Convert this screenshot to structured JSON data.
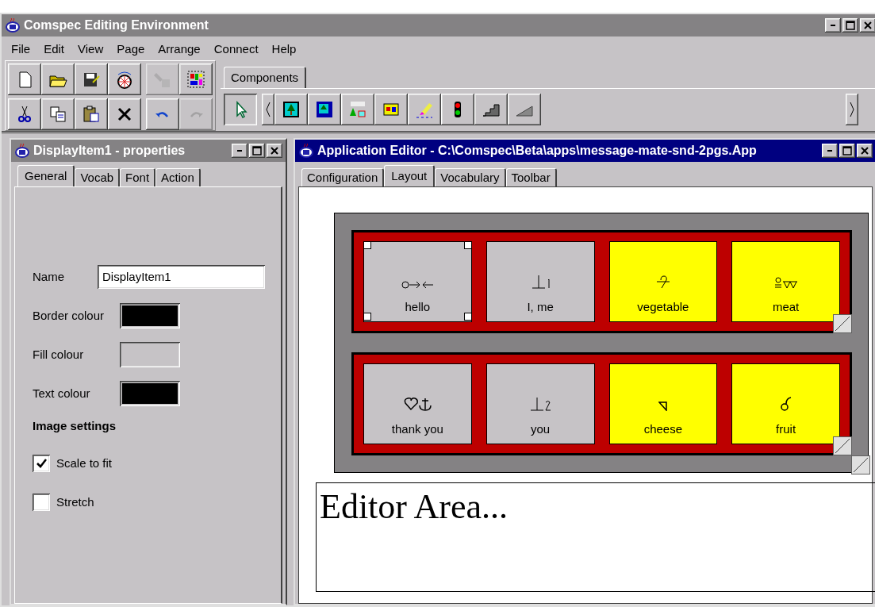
{
  "app_window": {
    "title": "Comspec Editing Environment",
    "active": false
  },
  "menu": [
    "File",
    "Edit",
    "View",
    "Page",
    "Arrange",
    "Connect",
    "Help"
  ],
  "toolbar": [
    [
      {
        "disabled": false
      },
      {
        "disabled": false
      },
      {
        "disabled": false
      },
      {
        "disabled": false
      },
      {
        "disabled": true
      },
      {
        "disabled": false
      }
    ],
    [
      {
        "disabled": false
      },
      {
        "disabled": false
      },
      {
        "disabled": false
      },
      {
        "disabled": false
      },
      {
        "disabled": false
      },
      {
        "disabled": true
      }
    ]
  ],
  "palette_tabs": [
    {
      "label": "Components",
      "selected": true
    }
  ],
  "palette": [
    {
      "selected": true
    },
    {
      "selected": false
    },
    {
      "selected": false
    },
    {
      "selected": false
    },
    {
      "selected": false
    },
    {
      "selected": false
    },
    {
      "selected": false
    },
    {
      "selected": false
    },
    {
      "selected": false
    }
  ],
  "properties": {
    "title": "DisplayItem1 - properties",
    "active": false,
    "tabs": [
      {
        "label": "General",
        "selected": true
      },
      {
        "label": "Vocab",
        "selected": false
      },
      {
        "label": "Font",
        "selected": false
      },
      {
        "label": "Action",
        "selected": false
      }
    ],
    "name_label": "Name",
    "name_value": "DisplayItem1",
    "colours": [
      {
        "label": "Border colour",
        "color": "#000000"
      },
      {
        "label": "Fill colour",
        "color": "#c6c3c6"
      },
      {
        "label": "Text colour",
        "color": "#000000"
      }
    ],
    "image_heading": "Image settings",
    "options": [
      {
        "label": "Scale to fit",
        "checked": true
      },
      {
        "label": "Stretch",
        "checked": false
      }
    ]
  },
  "editor": {
    "title": "Application Editor - C:\\Comspec\\Beta\\apps\\message-mate-snd-2pgs.App",
    "active": true,
    "tabs": [
      {
        "label": "Configuration",
        "selected": false
      },
      {
        "label": "Layout",
        "selected": true
      },
      {
        "label": "Vocabulary",
        "selected": false
      },
      {
        "label": "Toolbar",
        "selected": false
      }
    ],
    "rows": [
      {
        "cells": [
          {
            "label": "hello",
            "color": "#c6c3c6",
            "selected": true
          },
          {
            "label": "I, me",
            "color": "#c6c3c6",
            "selected": false
          },
          {
            "label": "vegetable",
            "color": "#ffff00",
            "selected": false
          },
          {
            "label": "meat",
            "color": "#ffff00",
            "selected": false
          }
        ]
      },
      {
        "cells": [
          {
            "label": "thank you",
            "color": "#c6c3c6",
            "selected": false
          },
          {
            "label": "you",
            "color": "#c6c3c6",
            "selected": false
          },
          {
            "label": "cheese",
            "color": "#ffff00",
            "selected": false
          },
          {
            "label": "fruit",
            "color": "#ffff00",
            "selected": false
          }
        ]
      }
    ],
    "editor_area": "Editor Area..."
  }
}
